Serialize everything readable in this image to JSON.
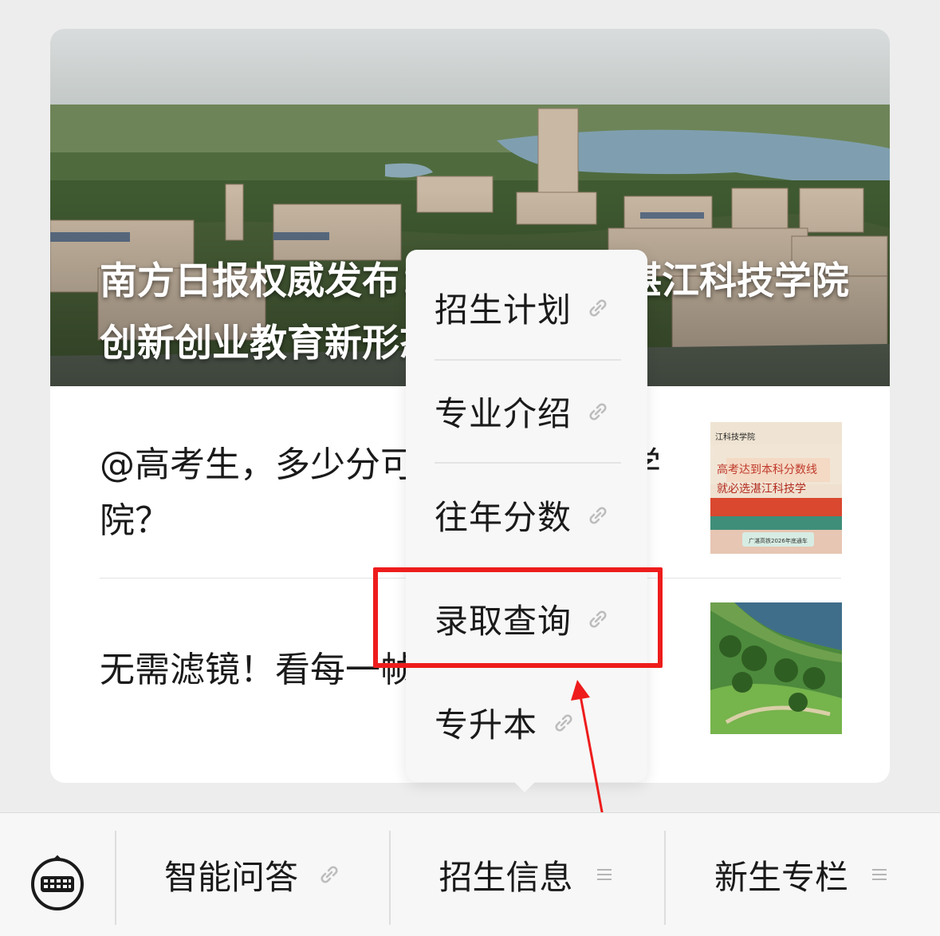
{
  "article": {
    "hero_title": "南方日报权威发布：多维度透视湛江科技学院创新创业教育新形态和…",
    "items": [
      {
        "title": "@高考生，多少分可以上湛江科技学院？"
      },
      {
        "title": "无需滤镜！看每一帧都美的校园"
      }
    ],
    "thumb1_texts": {
      "school": "江科技学院",
      "line1": "高考达到本科分数线",
      "line2": "就必选湛江科技学",
      "footer": "广湛高铁2026年底通车"
    }
  },
  "popup_menu": {
    "items": [
      {
        "label": "招生计划",
        "icon": "link-icon"
      },
      {
        "label": "专业介绍",
        "icon": "link-icon"
      },
      {
        "label": "往年分数",
        "icon": "link-icon"
      },
      {
        "label": "录取查询",
        "icon": "link-icon"
      },
      {
        "label": "专升本",
        "icon": "link-icon"
      }
    ]
  },
  "bottom_menu": {
    "keyboard_icon": "keyboard-icon",
    "tabs": [
      {
        "label": "智能问答",
        "icon": "link-icon"
      },
      {
        "label": "招生信息",
        "icon": "menu-icon"
      },
      {
        "label": "新生专栏",
        "icon": "menu-icon"
      }
    ]
  },
  "colors": {
    "highlight": "#ee1c1c",
    "background": "#ededed",
    "popup_bg": "#f7f7f7"
  }
}
